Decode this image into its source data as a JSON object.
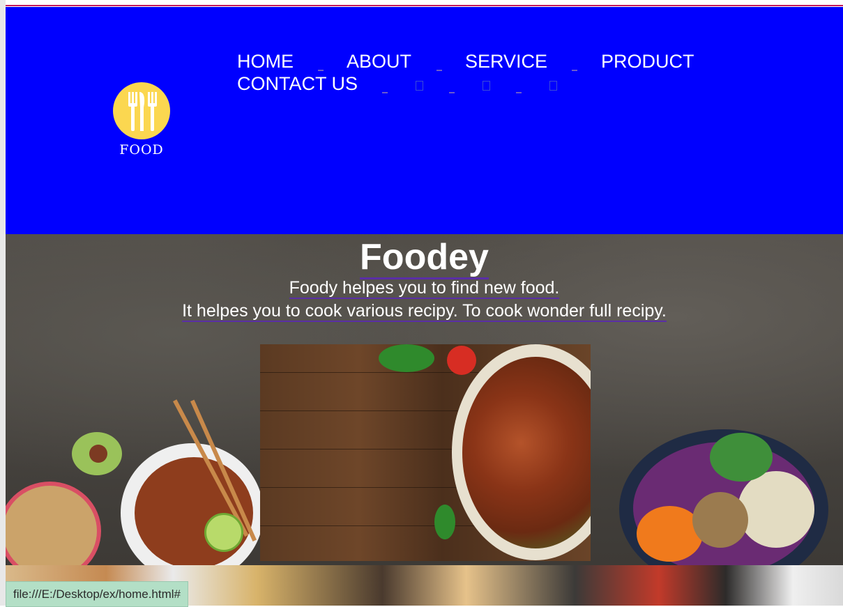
{
  "logo": {
    "text": "FOOD"
  },
  "nav": {
    "items": [
      {
        "label": "HOME"
      },
      {
        "label": "ABOUT"
      },
      {
        "label": "SERVICE"
      },
      {
        "label": "PRODUCT"
      },
      {
        "label": "CONTACT US"
      }
    ]
  },
  "hero": {
    "title": "Foodey",
    "line1": "Foody helpes you to find new food.",
    "line2": "It helpes you to cook various recipy. To cook wonder full recipy."
  },
  "status_bar": {
    "url": "file:///E:/Desktop/ex/home.html#"
  },
  "colors": {
    "header_bg": "#0000ff",
    "logo_circle": "#fbd750",
    "link_underline": "#5a2ea6",
    "status_bg": "#b3dfc6"
  },
  "icons": [
    "fork-knife-icon"
  ]
}
